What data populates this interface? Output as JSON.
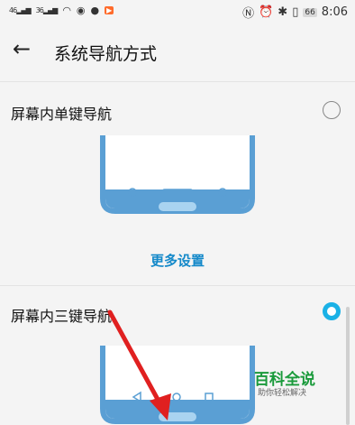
{
  "status_bar": {
    "signal1": "46",
    "signal2": "36",
    "battery": "66",
    "time": "8:06"
  },
  "header": {
    "title": "系统导航方式"
  },
  "options": [
    {
      "label": "屏幕内单键导航",
      "selected": false
    },
    {
      "label": "屏幕内三键导航",
      "selected": true
    }
  ],
  "more_settings": "更多设置",
  "watermark": {
    "title": "百科全说",
    "subtitle": "助你轻松解决"
  },
  "colors": {
    "accent": "#1ab1e6",
    "link": "#1489c9",
    "phone_frame": "#5a9fd4",
    "arrow": "#e02020"
  }
}
